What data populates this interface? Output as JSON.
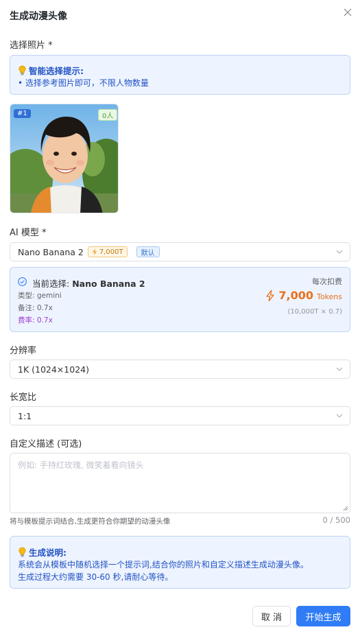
{
  "dialog": {
    "title": "生成动漫头像"
  },
  "photo_section": {
    "label": "选择照片 *",
    "tip_title": "智能选择提示:",
    "tip_text": "• 选择参考图片即可，不限人物数量",
    "photo": {
      "index_badge": "#1",
      "people_badge": "0人"
    }
  },
  "model_section": {
    "label": "AI 模型 *",
    "selected": "Nano Banana 2",
    "token_tag": "7,000T",
    "default_tag": "默认",
    "current_prefix": "当前选择:",
    "current_name": "Nano Banana 2",
    "type_line": "类型: gemini",
    "note_line": "备注: 0.7x",
    "rate_line": "费率: 0.7x",
    "each_label": "每次扣费",
    "cost_value": "7,000",
    "cost_unit": "Tokens",
    "formula": "(10,000T × 0.7)"
  },
  "resolution": {
    "label": "分辨率",
    "value": "1K (1024×1024)"
  },
  "aspect": {
    "label": "长宽比",
    "value": "1:1"
  },
  "description": {
    "label": "自定义描述 (可选)",
    "placeholder": "例如: 手持红玫瑰, 微笑着看向镜头",
    "hint": "将与模板提示词结合,生成更符合你期望的动漫头像",
    "counter": "0 / 500"
  },
  "explain": {
    "title": "生成说明:",
    "line1": "系统会从模板中随机选择一个提示词,结合你的照片和自定义描述生成动漫头像。",
    "line2": "生成过程大约需要 30-60 秒,请耐心等待。"
  },
  "footer": {
    "cancel": "取 消",
    "start": "开始生成"
  },
  "colors": {
    "primary": "#2f7cf6",
    "tip_bg": "#eef4ff",
    "tip_text": "#2152c4",
    "cost": "#e8701a",
    "rate": "#9b3fd0"
  }
}
